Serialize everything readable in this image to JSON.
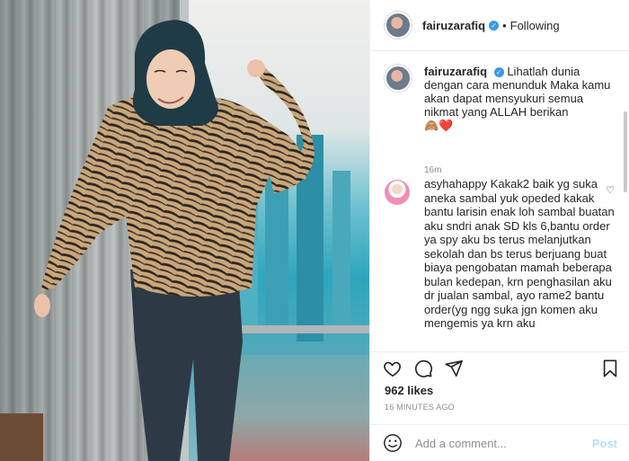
{
  "post": {
    "username": "fairuzarafiq",
    "verified_glyph": "✓",
    "separator": "•",
    "follow_status": "Following",
    "caption_text": "Lihatlah dunia dengan cara menunduk Maka kamu akan dapat mensyukuri semua nikmat yang ALLAH berikan",
    "caption_emoji": "🙈❤️",
    "caption_time": "16m",
    "likes": "962 likes",
    "timestamp": "16 MINUTES AGO"
  },
  "comment": {
    "username": "asyhahappy",
    "text": "Kakak2 baik yg suka aneka sambal yuk ореded kakak bantu larisin enak loh sambal buatan aku sndri anak SD kls 6,bantu order ya spy aku bs terus melanjutkan sekolah dan bs terus berjuang buat biaya pengobatan mamah beberapa bulan kedepan, krn penghasilan aku dr jualan sambal, ayo rame2 bantu order(yg ngg suka jgn komen aku mengemis ya krn aku"
  },
  "composer": {
    "placeholder": "Add a comment...",
    "post_label": "Post"
  },
  "icons": {
    "like": "heart-icon",
    "comment": "comment-icon",
    "share": "paper-plane-icon",
    "save": "bookmark-icon",
    "emoji": "smiley-icon"
  },
  "colors": {
    "verified": "#3897f0",
    "post_disabled": "#b2dffc",
    "muted": "#8e8e8e"
  }
}
